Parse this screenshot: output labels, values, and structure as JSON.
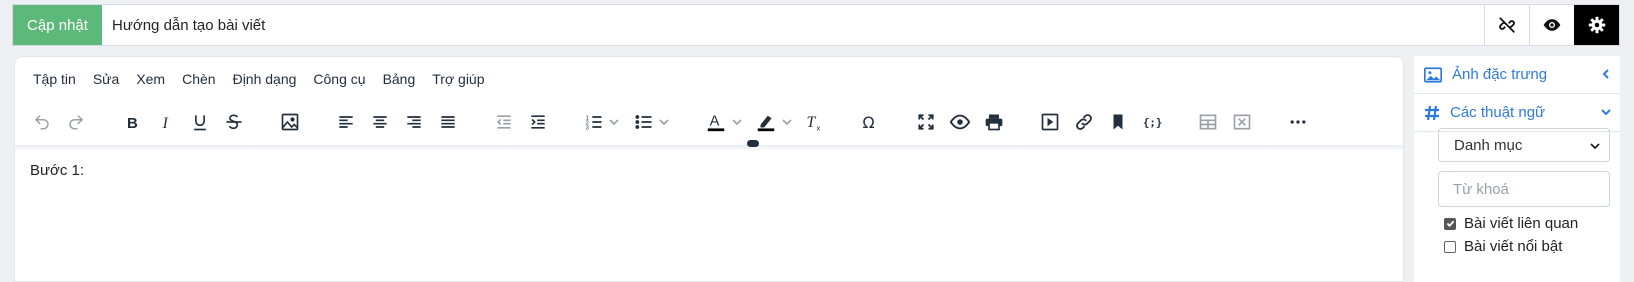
{
  "topbar": {
    "update_label": "Cập nhật",
    "title_value": "Hướng dẫn tạo bài viết",
    "icons": [
      "unlink-icon",
      "eye-icon",
      "gear-icon"
    ]
  },
  "editor": {
    "menu": [
      "Tập tin",
      "Sửa",
      "Xem",
      "Chèn",
      "Định dạng",
      "Công cụ",
      "Bảng",
      "Trợ giúp"
    ],
    "content": "Bước 1:"
  },
  "sidebar": {
    "featured_image": "Ảnh đặc trưng",
    "terms": "Các thuật ngữ",
    "category_select": "Danh mục",
    "keyword_placeholder": "Từ khoá",
    "related_label": "Bài viết liên quan",
    "related_checked": true,
    "featured_label": "Bài viết nổi bật",
    "featured_checked": false
  },
  "colors": {
    "accent_green": "#5cb979",
    "link_blue": "#2f7bd9",
    "toolbar_icon": "#222f3e"
  }
}
